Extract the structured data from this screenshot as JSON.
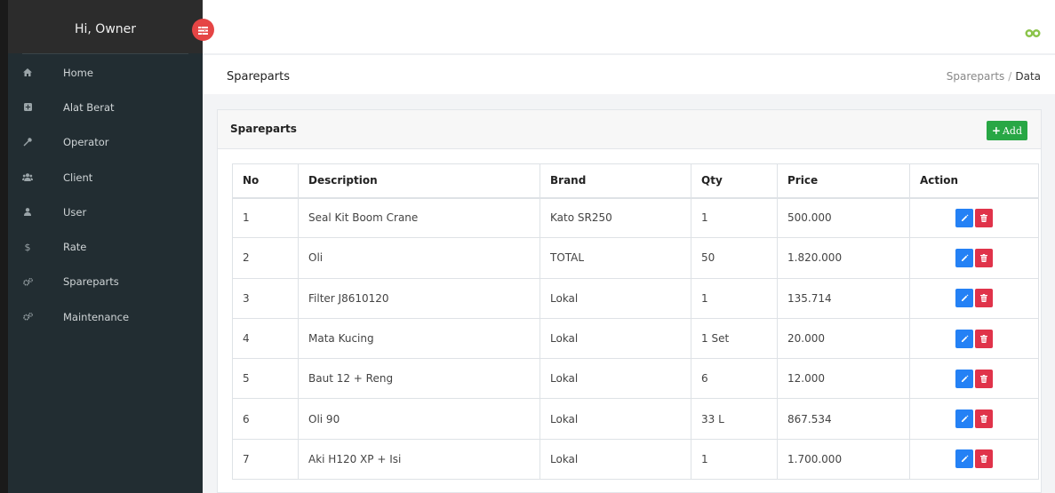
{
  "sidebar": {
    "greeting": "Hi, Owner",
    "items": [
      {
        "label": "Home",
        "icon": "home-icon"
      },
      {
        "label": "Alat Berat",
        "icon": "plus-square-icon"
      },
      {
        "label": "Operator",
        "icon": "wrench-icon"
      },
      {
        "label": "Client",
        "icon": "users-icon"
      },
      {
        "label": "User",
        "icon": "user-icon"
      },
      {
        "label": "Rate",
        "icon": "dollar-icon"
      },
      {
        "label": "Spareparts",
        "icon": "cogs-icon"
      },
      {
        "label": "Maintenance",
        "icon": "cogs-icon"
      }
    ]
  },
  "header": {
    "title": "Spareparts",
    "breadcrumb": [
      "Spareparts",
      "Data"
    ]
  },
  "card": {
    "title": "Spareparts",
    "add_label": "Add"
  },
  "table": {
    "columns": [
      "No",
      "Description",
      "Brand",
      "Qty",
      "Price",
      "Action"
    ],
    "rows": [
      {
        "no": "1",
        "description": "Seal Kit Boom Crane",
        "brand": "Kato SR250",
        "qty": "1",
        "price": "500.000"
      },
      {
        "no": "2",
        "description": "Oli",
        "brand": "TOTAL",
        "qty": "50",
        "price": "1.820.000"
      },
      {
        "no": "3",
        "description": "Filter J8610120",
        "brand": "Lokal",
        "qty": "1",
        "price": "135.714"
      },
      {
        "no": "4",
        "description": "Mata Kucing",
        "brand": "Lokal",
        "qty": "1 Set",
        "price": "20.000"
      },
      {
        "no": "5",
        "description": "Baut 12 + Reng",
        "brand": "Lokal",
        "qty": "6",
        "price": "12.000"
      },
      {
        "no": "6",
        "description": "Oli 90",
        "brand": "Lokal",
        "qty": "33 L",
        "price": "867.534"
      },
      {
        "no": "7",
        "description": "Aki H120 XP + Isi",
        "brand": "Lokal",
        "qty": "1",
        "price": "1.700.000"
      }
    ]
  },
  "colors": {
    "sidebar_bg": "#222d32",
    "toggle": "#e54545",
    "add_button": "#28a745",
    "edit_button": "#2481f5",
    "delete_button": "#e0334a",
    "logo": "#8bc34a"
  }
}
